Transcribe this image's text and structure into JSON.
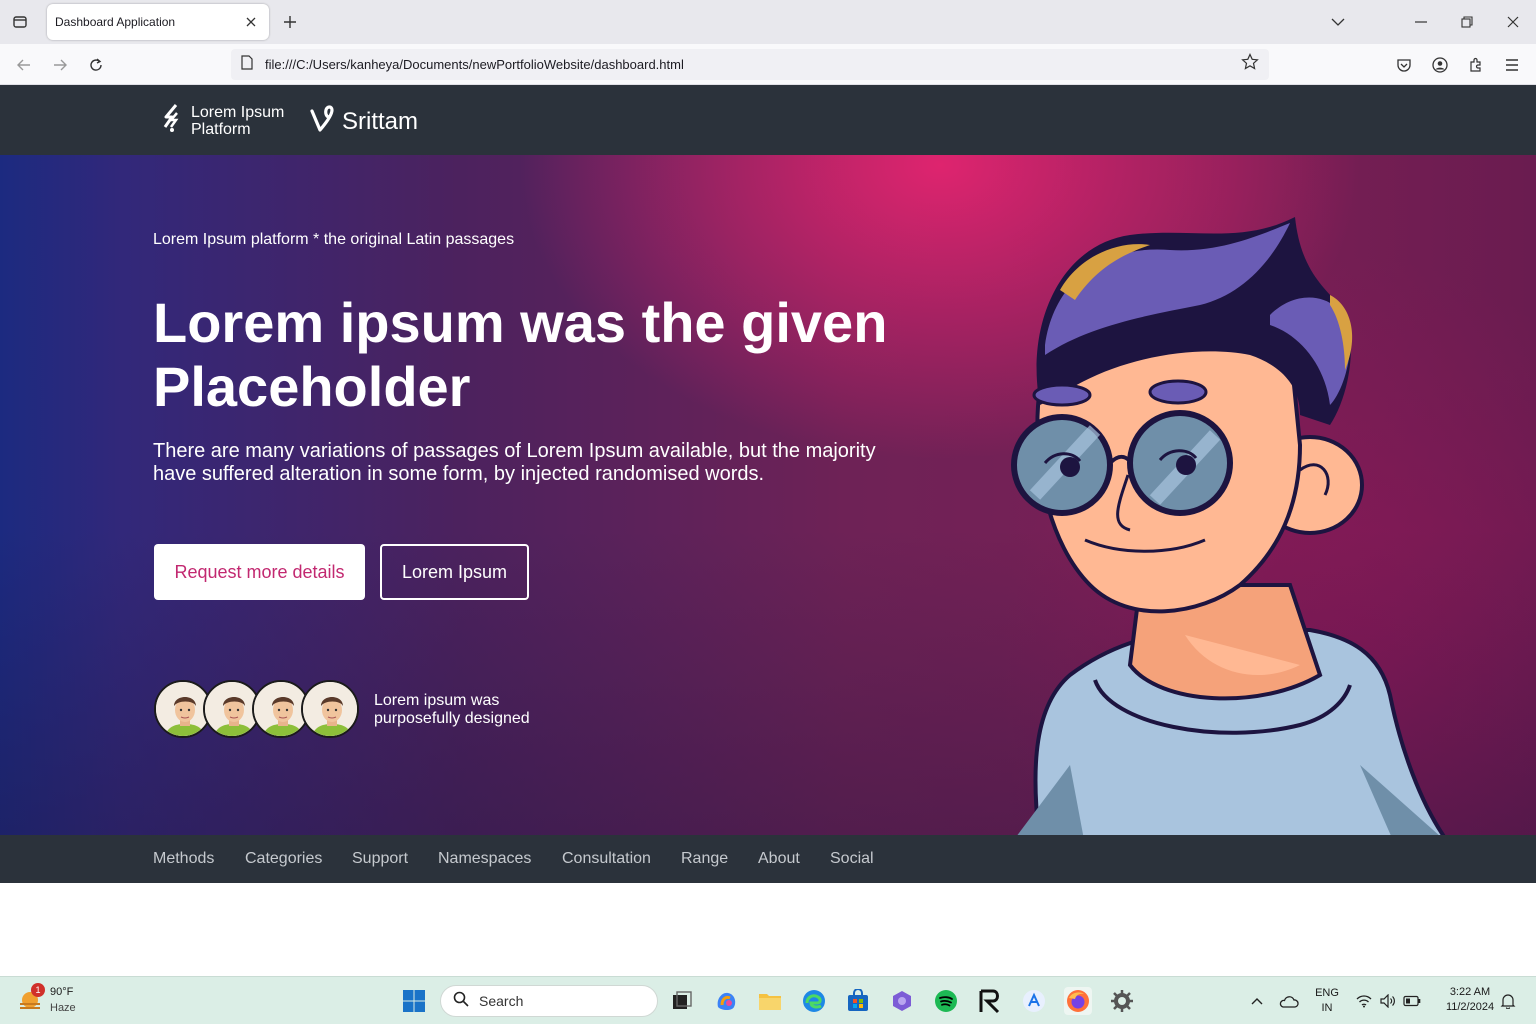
{
  "browser": {
    "tab_title": "Dashboard Application",
    "url": "file:///C:/Users/kanheya/Documents/newPortfolioWebsite/dashboard.html"
  },
  "site": {
    "brand_line1": "Lorem Ipsum",
    "brand_line2": "Platform",
    "brand2": "Srittam"
  },
  "hero": {
    "eyebrow": "Lorem Ipsum platform * the original Latin passages",
    "title": "Lorem ipsum was the given Placeholder",
    "description": "There are many variations of passages of Lorem Ipsum available, but the majority have suffered alteration in some form, by injected randomised words.",
    "primary_button": "Request more details",
    "secondary_button": "Lorem Ipsum",
    "avatars_caption": "Lorem ipsum was purposefully designed"
  },
  "sub_nav": {
    "items": [
      "Methods",
      "Categories",
      "Support",
      "Namespaces",
      "Consultation",
      "Range",
      "About",
      "Social"
    ]
  },
  "taskbar": {
    "weather_temp": "90°F",
    "weather_desc": "Haze",
    "weather_badge": "1",
    "search_placeholder": "Search",
    "lang_line1": "ENG",
    "lang_line2": "IN",
    "time": "3:22 AM",
    "date": "11/2/2024"
  },
  "colors": {
    "header_bg": "#2b323b",
    "accent_pink": "#c22870",
    "hero_start": "#1c2a80",
    "hero_end": "#7a1f55"
  }
}
